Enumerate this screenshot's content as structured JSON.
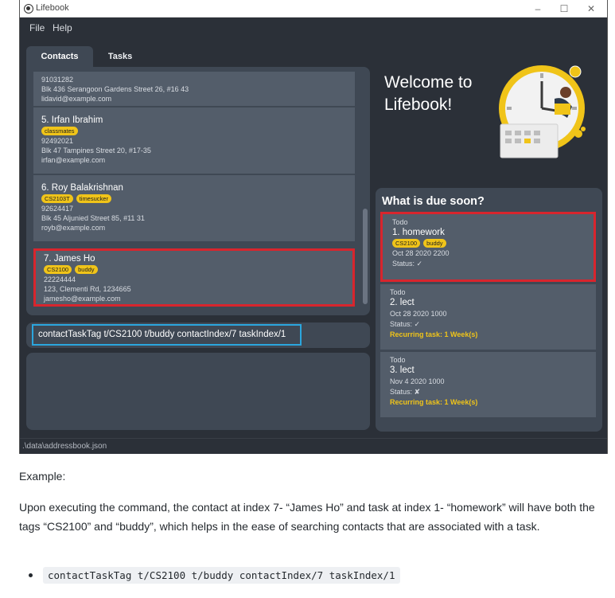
{
  "window": {
    "title": "Lifebook",
    "min_glyph": "–",
    "max_glyph": "☐",
    "close_glyph": "✕"
  },
  "menu": {
    "file": "File",
    "help": "Help"
  },
  "tabs": {
    "contacts": "Contacts",
    "tasks": "Tasks"
  },
  "contacts": {
    "partial": {
      "phone": "91031282",
      "address": "Blk 436 Serangoon Gardens Street 26, #16 43",
      "email": "lidavid@example.com"
    },
    "items": [
      {
        "name": "5.  Irfan Ibrahim",
        "tags": [
          "classmates"
        ],
        "phone": "92492021",
        "address": "Blk 47 Tampines Street 20, #17-35",
        "email": "irfan@example.com"
      },
      {
        "name": "6.  Roy Balakrishnan",
        "tags": [
          "CS2103T",
          "timesucker"
        ],
        "phone": "92624417",
        "address": "Blk 45 Aljunied Street 85, #11 31",
        "email": "royb@example.com"
      },
      {
        "name": "7.  James Ho",
        "tags": [
          "CS2100",
          "buddy"
        ],
        "phone": "22224444",
        "address": "123, Clementi Rd, 1234665",
        "email": "jamesho@example.com"
      }
    ]
  },
  "command": {
    "value": "contactTaskTag t/CS2100 t/buddy contactIndex/7 taskIndex/1"
  },
  "welcome": {
    "line1": "Welcome to",
    "line2": "Lifebook!"
  },
  "due": {
    "title": "What is due soon?",
    "tasks": [
      {
        "type": "Todo",
        "name": "1.  homework",
        "tags": [
          "CS2100",
          "buddy"
        ],
        "date": "Oct 28 2020 2200",
        "status": "Status: ✓",
        "recurring": ""
      },
      {
        "type": "Todo",
        "name": "2.  lect",
        "date": "Oct 28 2020 1000",
        "status": "Status: ✓",
        "recurring": "Recurring task: 1 Week(s)"
      },
      {
        "type": "Todo",
        "name": "3.  lect",
        "date": "Nov 4 2020 1000",
        "status": "Status: ✘",
        "recurring": "Recurring task: 1 Week(s)"
      }
    ]
  },
  "status_bar": {
    "path": ".\\data\\addressbook.json"
  },
  "doc": {
    "label": "Example:",
    "paragraph": "Upon executing the command, the contact at index 7- “James Ho” and task at index 1- “homework” will have both the tags “CS2100” and “buddy”, which helps in the ease of searching contacts that are associated with a task.",
    "code": "contactTaskTag t/CS2100 t/buddy contactIndex/7 taskIndex/1"
  },
  "colors": {
    "accent_tag": "#f0c419",
    "selection_border": "#d8252d",
    "command_border": "#2ba6de",
    "panel_bg": "#3f4854",
    "window_bg": "#2b3038"
  }
}
